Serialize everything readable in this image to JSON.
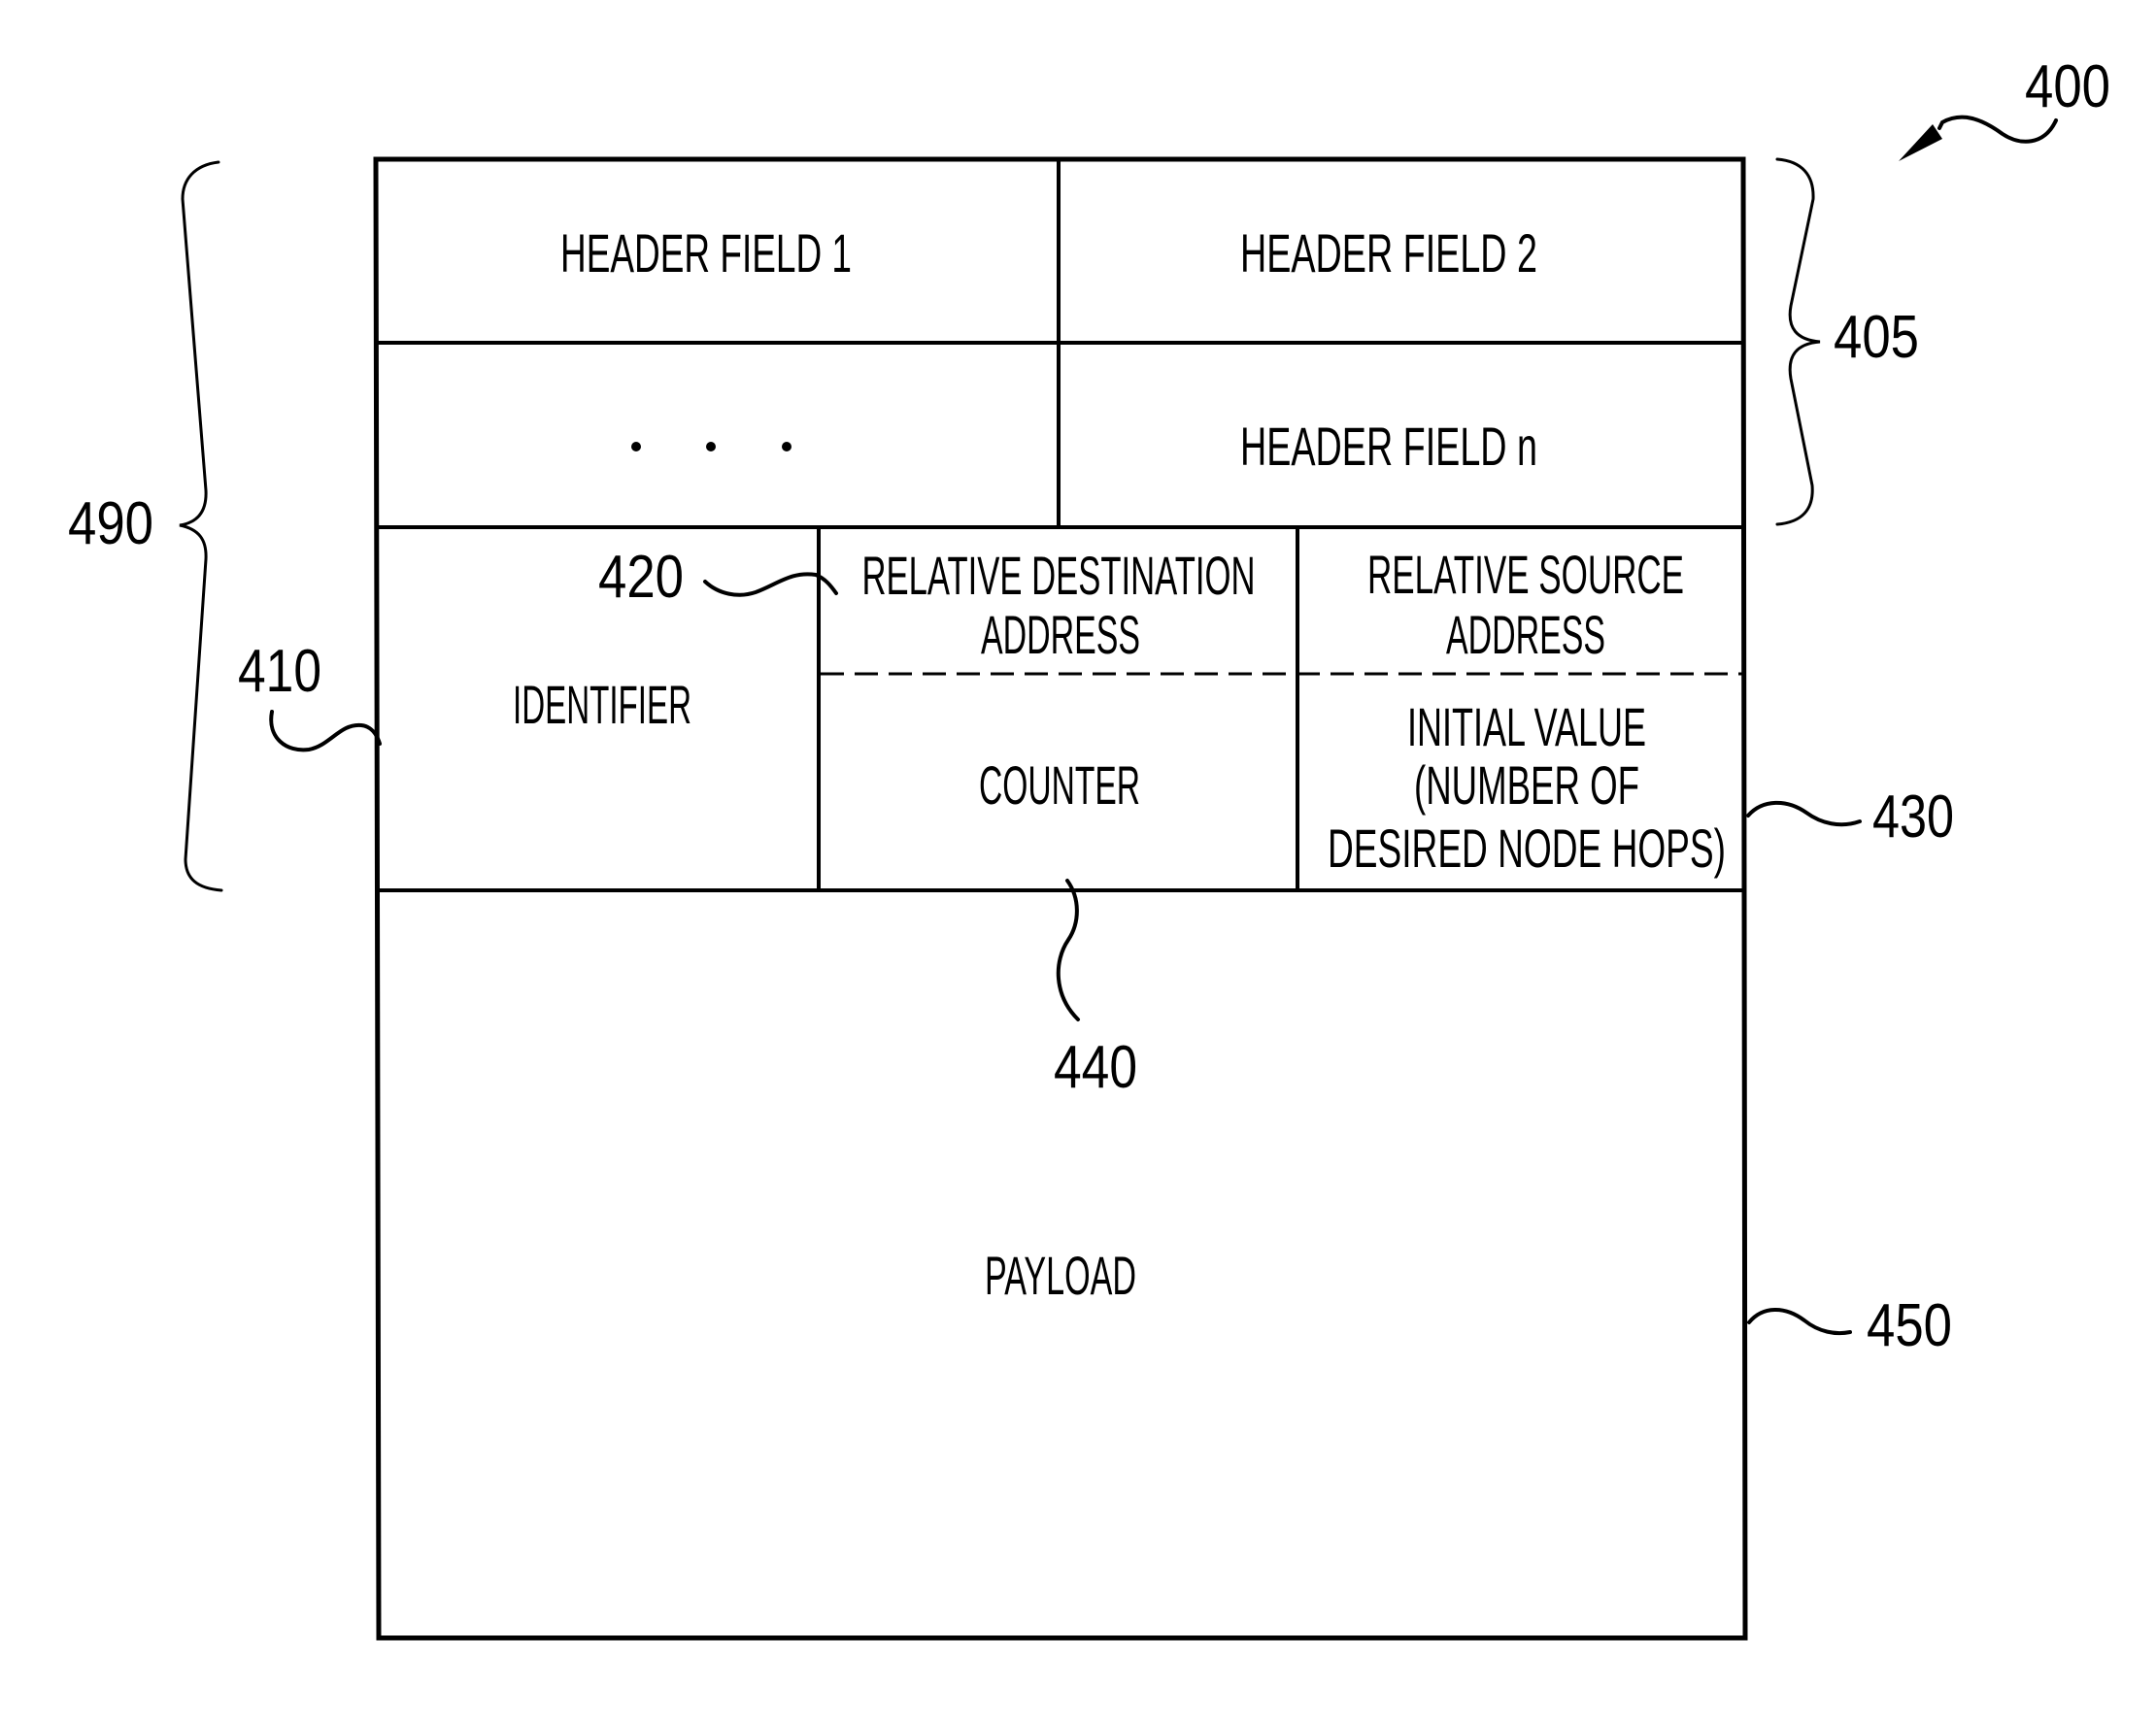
{
  "figure": {
    "reference_number": "400",
    "header_section": {
      "reference_number": "405",
      "fields": [
        {
          "label": "HEADER FIELD 1"
        },
        {
          "label": "HEADER FIELD 2"
        },
        {
          "label": "· · ·"
        },
        {
          "label": "HEADER FIELD n"
        }
      ]
    },
    "overall_header_reference": "490",
    "identifier": {
      "reference_number": "410",
      "label": "IDENTIFIER"
    },
    "relative_destination_address": {
      "reference_number": "420",
      "lines": [
        "RELATIVE DESTINATION",
        "ADDRESS"
      ]
    },
    "relative_source_address": {
      "lines": [
        "RELATIVE SOURCE",
        "ADDRESS"
      ]
    },
    "counter": {
      "reference_number": "440",
      "label": "COUNTER"
    },
    "initial_value": {
      "reference_number": "430",
      "lines": [
        "INITIAL VALUE",
        "(NUMBER OF",
        "DESIRED NODE HOPS)"
      ]
    },
    "payload": {
      "reference_number": "450",
      "label": "PAYLOAD"
    }
  }
}
